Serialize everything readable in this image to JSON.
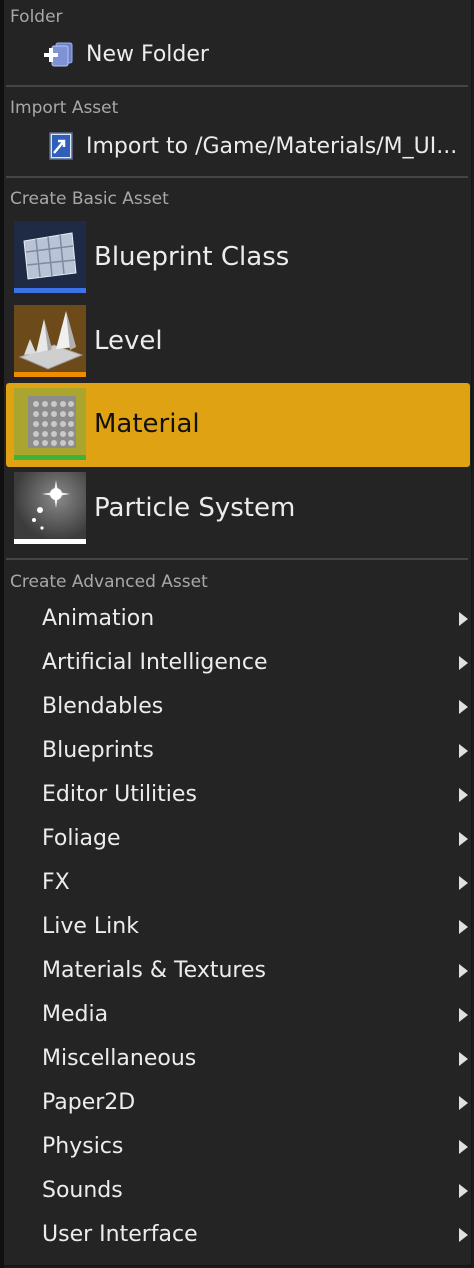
{
  "sections": {
    "folder": "Folder",
    "import": "Import Asset",
    "basic": "Create Basic Asset",
    "advanced": "Create Advanced Asset"
  },
  "folder_items": [
    {
      "label": "New Folder",
      "icon": "new-folder-icon"
    }
  ],
  "import_items": [
    {
      "label": "Import to /Game/Materials/M_UI...",
      "icon": "import-icon"
    }
  ],
  "basic_items": [
    {
      "label": "Blueprint Class",
      "icon": "blueprint-class-icon",
      "accent": "#3a74e8",
      "active": false
    },
    {
      "label": "Level",
      "icon": "level-icon",
      "accent": "#f08c00",
      "active": false
    },
    {
      "label": "Material",
      "icon": "material-icon",
      "accent": "#3cb43c",
      "active": true
    },
    {
      "label": "Particle System",
      "icon": "particle-system-icon",
      "accent": "#ffffff",
      "active": false
    }
  ],
  "advanced_items": [
    {
      "label": "Animation"
    },
    {
      "label": "Artificial Intelligence"
    },
    {
      "label": "Blendables"
    },
    {
      "label": "Blueprints"
    },
    {
      "label": "Editor Utilities"
    },
    {
      "label": "Foliage"
    },
    {
      "label": "FX"
    },
    {
      "label": "Live Link"
    },
    {
      "label": "Materials & Textures"
    },
    {
      "label": "Media"
    },
    {
      "label": "Miscellaneous"
    },
    {
      "label": "Paper2D"
    },
    {
      "label": "Physics"
    },
    {
      "label": "Sounds"
    },
    {
      "label": "User Interface"
    }
  ],
  "colors": {
    "highlight": "#dfa212",
    "menu_bg": "#242424",
    "separator": "#454545"
  }
}
